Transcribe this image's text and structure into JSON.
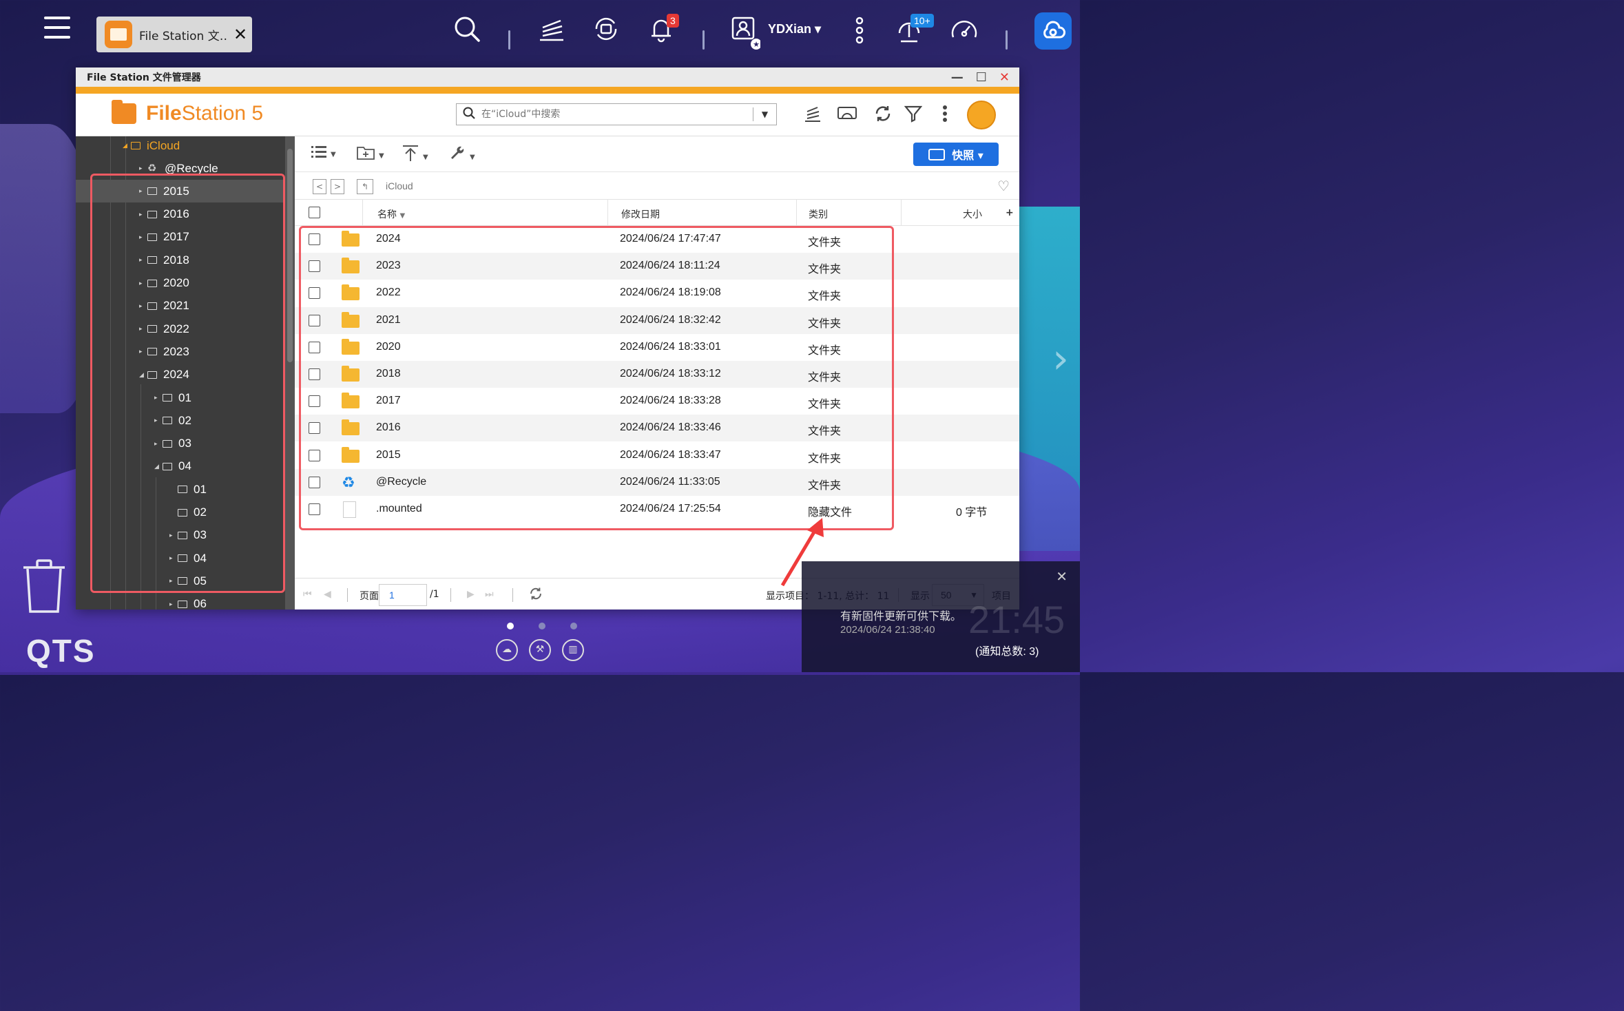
{
  "taskbar": {
    "tab_label": "File Station 文…",
    "user_name": "YDXian ▾",
    "notification_badge": "3",
    "update_badge": "10+"
  },
  "window": {
    "title": "File Station 文件管理器",
    "logo_bold": "File",
    "logo_rest": "Station 5",
    "search_placeholder": "在“iCloud”中搜索",
    "snapshot_label": "快照 ▾"
  },
  "tree": {
    "root": "iCloud",
    "items": [
      {
        "label": "@Recycle",
        "level": 2
      },
      {
        "label": "2015",
        "level": 2,
        "selected": true
      },
      {
        "label": "2016",
        "level": 2
      },
      {
        "label": "2017",
        "level": 2
      },
      {
        "label": "2018",
        "level": 2
      },
      {
        "label": "2020",
        "level": 2
      },
      {
        "label": "2021",
        "level": 2
      },
      {
        "label": "2022",
        "level": 2
      },
      {
        "label": "2023",
        "level": 2
      },
      {
        "label": "2024",
        "level": 2,
        "expanded": true
      },
      {
        "label": "01",
        "level": 3
      },
      {
        "label": "02",
        "level": 3
      },
      {
        "label": "03",
        "level": 3
      },
      {
        "label": "04",
        "level": 3,
        "expanded": true
      },
      {
        "label": "01",
        "level": 4
      },
      {
        "label": "02",
        "level": 4
      },
      {
        "label": "03",
        "level": 4
      },
      {
        "label": "04",
        "level": 4
      },
      {
        "label": "05",
        "level": 4
      },
      {
        "label": "06",
        "level": 4
      }
    ]
  },
  "path": "iCloud",
  "columns": {
    "name": "名称",
    "modified": "修改日期",
    "type": "类别",
    "size": "大小"
  },
  "files": [
    {
      "name": "2024",
      "modified": "2024/06/24 17:47:47",
      "type": "文件夹",
      "size": "",
      "icon": "folder-icon"
    },
    {
      "name": "2023",
      "modified": "2024/06/24 18:11:24",
      "type": "文件夹",
      "size": "",
      "icon": "folder-icon"
    },
    {
      "name": "2022",
      "modified": "2024/06/24 18:19:08",
      "type": "文件夹",
      "size": "",
      "icon": "folder-icon"
    },
    {
      "name": "2021",
      "modified": "2024/06/24 18:32:42",
      "type": "文件夹",
      "size": "",
      "icon": "folder-icon"
    },
    {
      "name": "2020",
      "modified": "2024/06/24 18:33:01",
      "type": "文件夹",
      "size": "",
      "icon": "folder-icon"
    },
    {
      "name": "2018",
      "modified": "2024/06/24 18:33:12",
      "type": "文件夹",
      "size": "",
      "icon": "folder-icon"
    },
    {
      "name": "2017",
      "modified": "2024/06/24 18:33:28",
      "type": "文件夹",
      "size": "",
      "icon": "folder-icon"
    },
    {
      "name": "2016",
      "modified": "2024/06/24 18:33:46",
      "type": "文件夹",
      "size": "",
      "icon": "folder-icon"
    },
    {
      "name": "2015",
      "modified": "2024/06/24 18:33:47",
      "type": "文件夹",
      "size": "",
      "icon": "folder-icon"
    },
    {
      "name": "@Recycle",
      "modified": "2024/06/24 11:33:05",
      "type": "文件夹",
      "size": "",
      "icon": "recycle-icon"
    },
    {
      "name": ".mounted",
      "modified": "2024/06/24 17:25:54",
      "type": "隐藏文件",
      "size": "0 字节",
      "icon": "file-icon"
    }
  ],
  "footer": {
    "page_label": "页面",
    "page_value": "1",
    "page_total": "/1",
    "showing": "显示项目： 1-11, 总计： 11",
    "show_label": "显示",
    "per_page": "50",
    "items_label": "项目"
  },
  "notification": {
    "message": "有新固件更新可供下载。",
    "time": "2024/06/24 21:38:40",
    "clock": "21:45",
    "count": "(通知总数: 3)"
  },
  "desktop": {
    "brand": "QTS"
  },
  "colors": {
    "accent": "#f08a24",
    "highlight": "#ef5a62",
    "blue": "#1e6fe0"
  }
}
